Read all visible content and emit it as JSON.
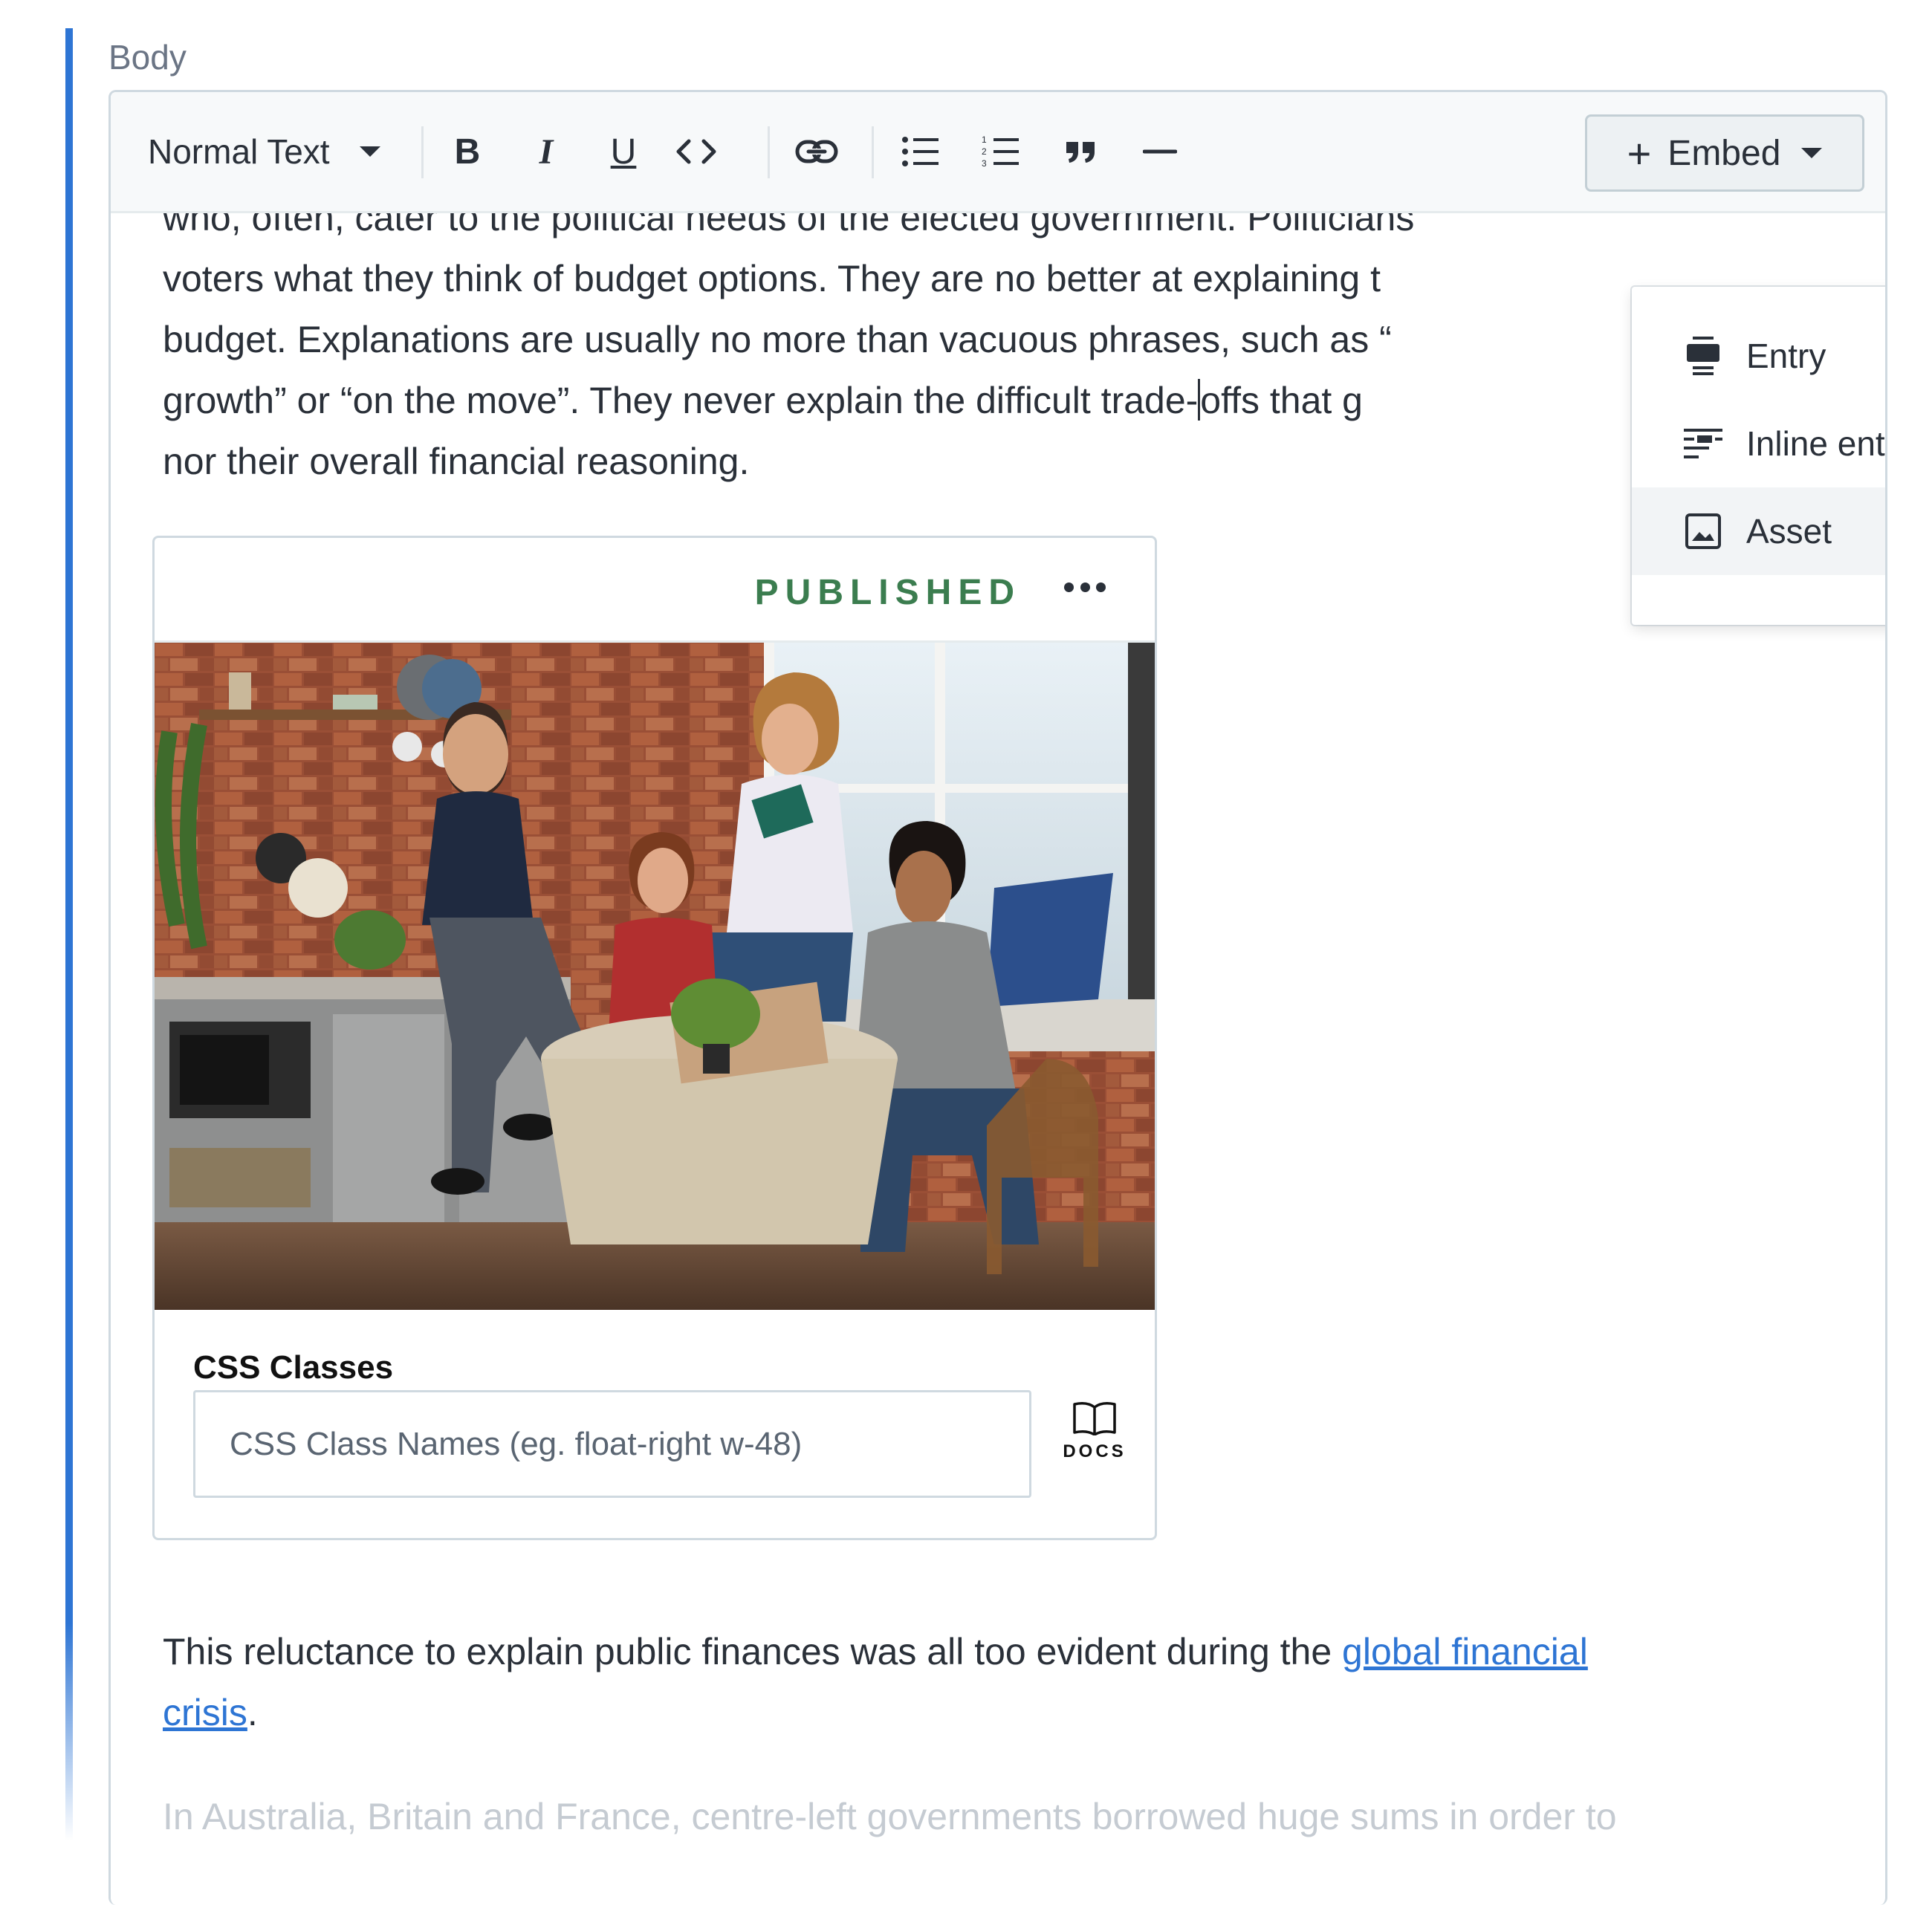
{
  "field": {
    "label": "Body"
  },
  "toolbar": {
    "style_select": "Normal Text",
    "buttons": {
      "bold": "B",
      "italic": "I",
      "underline": "U",
      "code": "<>"
    },
    "embed": {
      "plus": "+",
      "label": "Embed"
    }
  },
  "embed_menu": {
    "items": [
      {
        "label": "Entry",
        "icon": "entry-icon"
      },
      {
        "label": "Inline entry",
        "icon": "inline-entry-icon"
      },
      {
        "label": "Asset",
        "icon": "image-icon",
        "highlighted": true
      }
    ]
  },
  "content": {
    "paragraph_top": {
      "line1": "who, often, cater to the political needs of the elected government. Politicians",
      "line2": "voters what they think of budget options. They are no better at explaining t",
      "line3": "budget. Explanations are usually no more than vacuous phrases, such as “",
      "line4a": "growth” or “on the move”. They never explain the difficult trade-",
      "line4b": "offs that g",
      "line5": "nor their overall financial reasoning."
    },
    "asset_card": {
      "status": "PUBLISHED",
      "status_color": "#3b7d4f",
      "css_label": "CSS Classes",
      "css_placeholder": "CSS Class Names (eg. float-right w-48)",
      "docs_label": "DOCS"
    },
    "paragraph_bottom": {
      "text": "This reluctance to explain public finances was all too evident during the ",
      "link_line1": "global financial ",
      "link_line2": "crisis",
      "end": "."
    },
    "paragraph_faded": "In Australia, Britain and France, centre-left governments borrowed huge sums in order to"
  },
  "colors": {
    "accent": "#2e75d4",
    "link": "#2e75d4",
    "published": "#3b7d4f"
  }
}
